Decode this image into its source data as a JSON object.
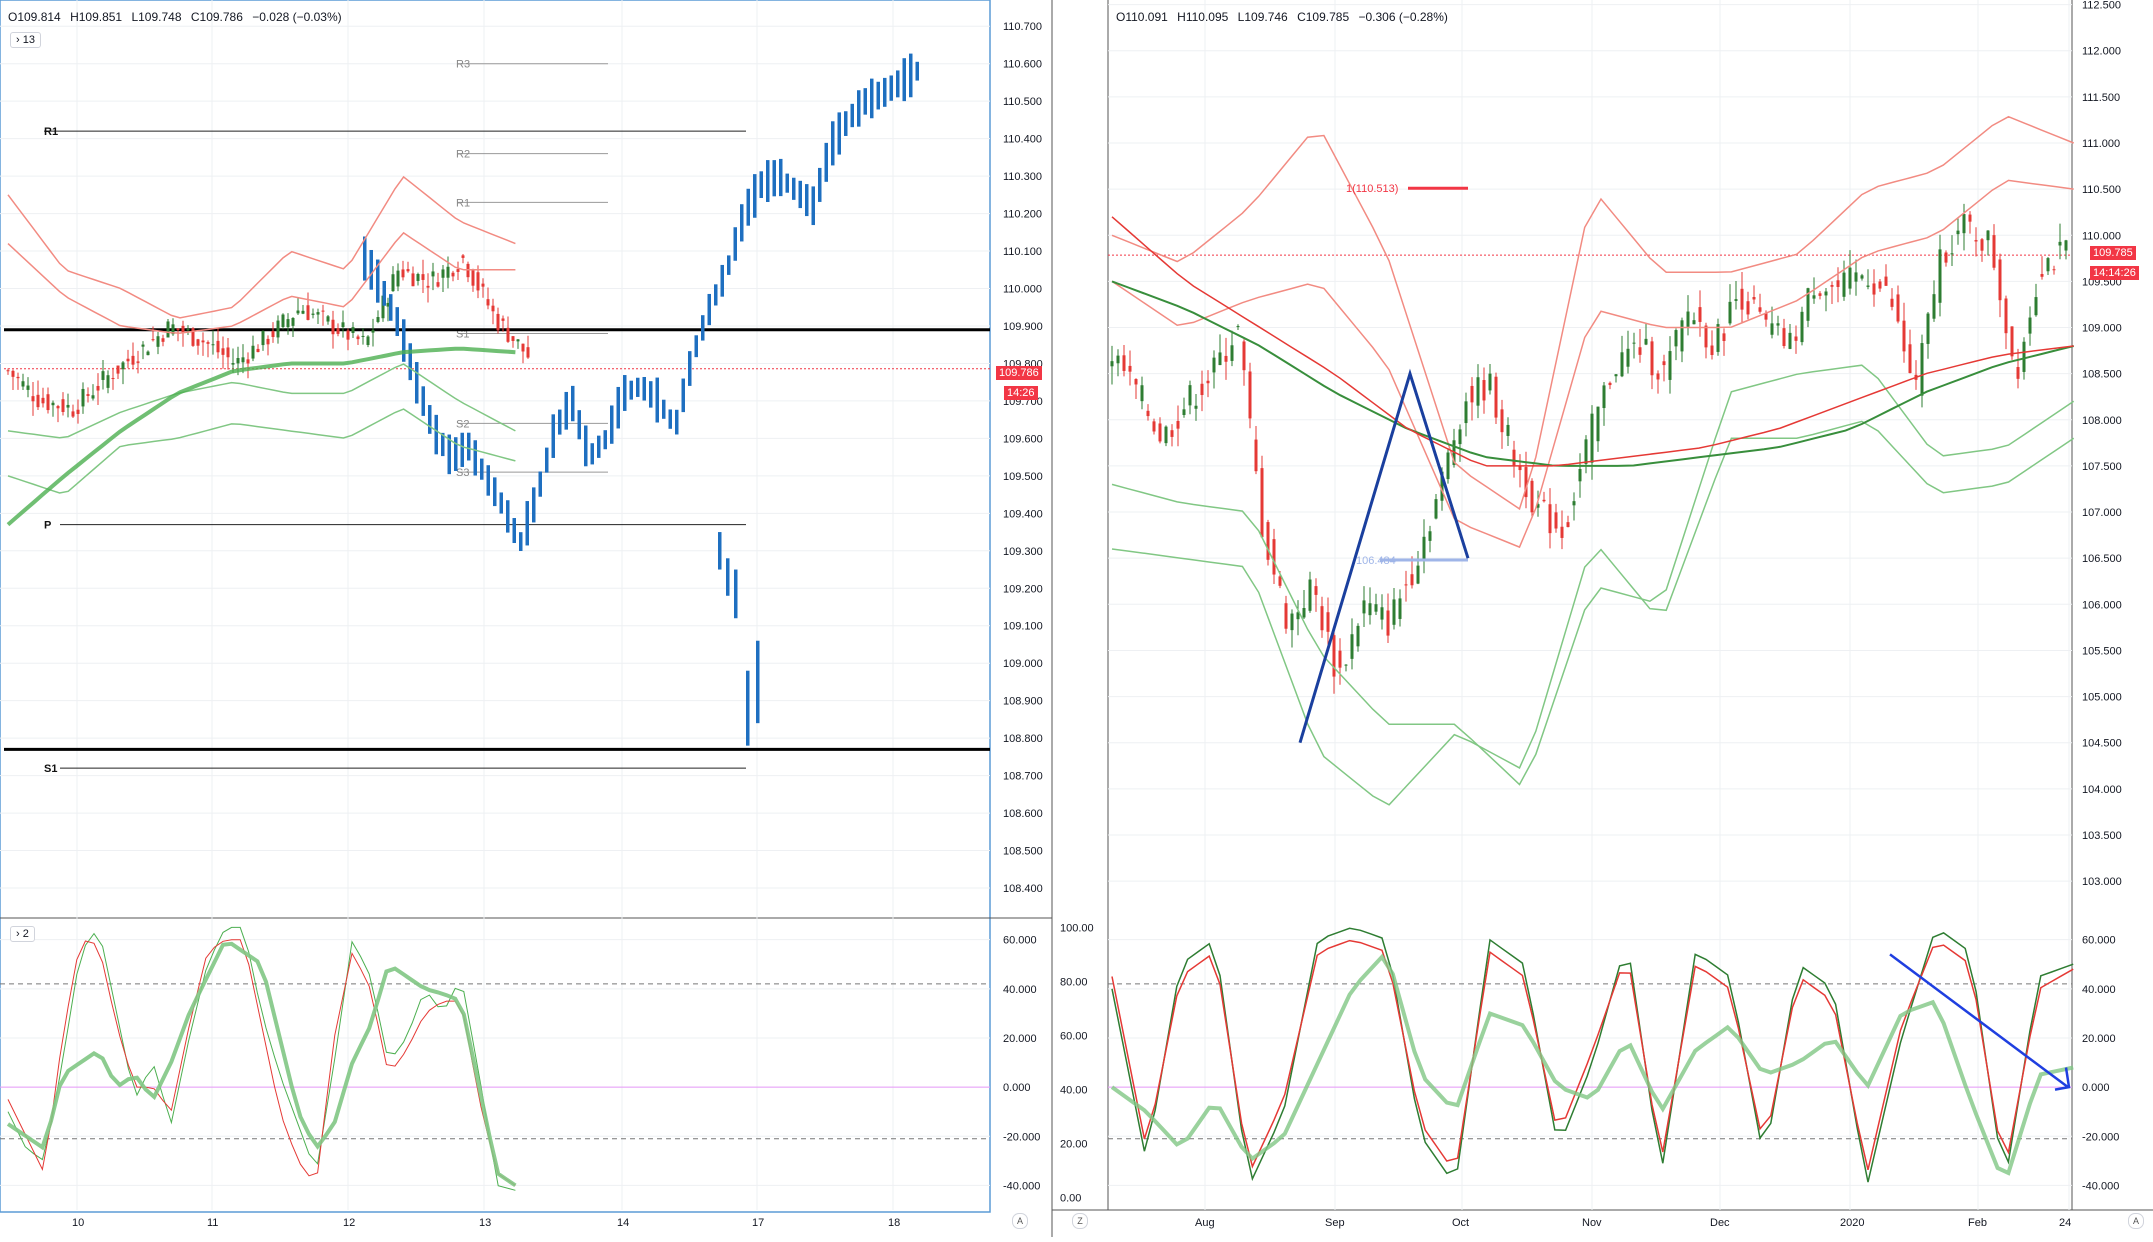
{
  "colors": {
    "up": "#2e7d32",
    "down": "#e53935",
    "blue_bar": "#1e6fc0",
    "band_red": "#f28b82",
    "band_green": "#81c784",
    "grid": "#eef0f3",
    "axis_text": "#131722",
    "price_tag": "#f23645"
  },
  "left": {
    "legend": {
      "o": "O109.814",
      "h": "H109.851",
      "l": "L109.748",
      "c": "C109.786",
      "chg": "−0.028 (−0.03%)"
    },
    "chip_main": "13",
    "chip_osc": "2",
    "price_tag": "109.786",
    "time_tag": "14:26",
    "corner": "A",
    "chart_data": {
      "type": "candlestick",
      "ylim": [
        108.32,
        110.77
      ],
      "y_ticks": [
        "110.700",
        "110.600",
        "110.500",
        "110.400",
        "110.300",
        "110.200",
        "110.100",
        "110.000",
        "109.900",
        "109.800",
        "109.700",
        "109.600",
        "109.500",
        "109.400",
        "109.300",
        "109.200",
        "109.100",
        "109.000",
        "108.900",
        "108.800",
        "108.700",
        "108.600",
        "108.500",
        "108.400"
      ],
      "x_ticks": [
        "10",
        "11",
        "12",
        "13",
        "14",
        "17",
        "18"
      ],
      "pivot_levels": [
        {
          "label": "R3",
          "value": 110.6
        },
        {
          "label": "R1",
          "value": 110.42
        },
        {
          "label": "R2",
          "value": 110.36
        },
        {
          "label": "R1",
          "value": 110.23
        },
        {
          "label": "S1",
          "value": 109.88
        },
        {
          "label": "S2",
          "value": 109.64
        },
        {
          "label": "S3",
          "value": 109.51
        },
        {
          "label": "P",
          "value": 109.37
        },
        {
          "label": "S1",
          "value": 108.72
        }
      ],
      "horizontal_lines": [
        109.89,
        108.77
      ],
      "last_price": 109.786,
      "oscillator": {
        "y_ticks": [
          "60.000",
          "40.000",
          "20.000",
          "0.000",
          "-20.000",
          "-40.000"
        ],
        "ylim": [
          -50,
          68
        ],
        "levels": [
          42,
          0,
          -21
        ]
      }
    }
  },
  "right": {
    "legend": {
      "o": "O110.091",
      "h": "H110.095",
      "l": "L109.746",
      "c": "C109.785",
      "chg": "−0.306 (−0.28%)"
    },
    "price_tag": "109.785",
    "time_tag": "14:14:26",
    "fib_label": "1(110.513)",
    "fib_label2": "106.484",
    "corner_left": "Z",
    "corner_right": "A",
    "chart_data": {
      "type": "candlestick",
      "ylim": [
        102.6,
        112.55
      ],
      "y_ticks": [
        "112.500",
        "112.000",
        "111.500",
        "111.000",
        "110.500",
        "110.000",
        "109.500",
        "109.000",
        "108.500",
        "108.000",
        "107.500",
        "107.000",
        "106.500",
        "106.000",
        "105.500",
        "105.000",
        "104.500",
        "104.000",
        "103.500",
        "103.000"
      ],
      "x_ticks": [
        "Aug",
        "Sep",
        "Oct",
        "Nov",
        "Dec",
        "2020",
        "Feb",
        "24"
      ],
      "last_price": 109.785,
      "oscillator": {
        "left_ticks": [
          "100.00",
          "80.00",
          "60.00",
          "40.00",
          "20.00",
          "0.00"
        ],
        "right_ticks": [
          "60.000",
          "40.000",
          "20.000",
          "0.000",
          "-20.000",
          "-40.000"
        ],
        "ylim": [
          -50,
          68
        ],
        "levels": [
          42,
          0,
          -21
        ]
      }
    }
  }
}
